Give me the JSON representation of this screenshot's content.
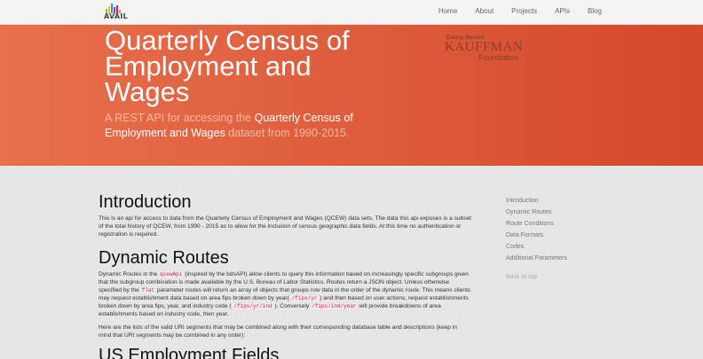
{
  "navbar": {
    "logo_text": "AVAIL",
    "logo_colors": [
      "#8bc34a",
      "#ffc107",
      "#03a9f4",
      "#e91e63",
      "#9c27b0",
      "#ff9800"
    ],
    "links": [
      "Home",
      "About",
      "Projects",
      "APIs",
      "Blog"
    ]
  },
  "hero": {
    "title": "Quarterly Census of Employment and Wages",
    "subtitle_pre": "A REST API for accessing the ",
    "subtitle_highlight": "Quarterly Census of Employment and Wages",
    "subtitle_post": " dataset from 1990-2015.",
    "sponsor": {
      "top": "Ewing Marion",
      "main": "KAUFFMAN",
      "bottom": "Foundation"
    },
    "colors": {
      "start": "#e8704c",
      "end": "#d4492b"
    }
  },
  "intro": {
    "heading": "Introduction",
    "text": "This is an api for access to data from the Quarterly Census of Employment and Wages (QCEW) data sets. The data this api exposes is a subset of the total history of QCEW, from 1990 - 2015 as to allow for the inclusion of census geographic data fields. At this time no authentication or registration is required."
  },
  "dynamic": {
    "heading": "Dynamic Routes",
    "p1_a": "Dynamic Routes in the ",
    "p1_code1": "qcewApi",
    "p1_b": " (inspired by the bdsAPI) allow clients to query this information based on increasingly specific subgroups given that the subgroup combination is made available by the U.S. Bureau of Labor Statistics. Routes return a JSON object. Unless otherwise specified by the ",
    "p1_code2": "flat",
    "p1_c": " parameter routes will return an array of objects that groups row data in the order of the dynamic route. This means clients may request establishment data based on area fips broken down by year( ",
    "p1_code3": "/fips/yr",
    "p1_d": " ) and then based on user actions, request establishments broken down by area fips, year, and industry code ( ",
    "p1_code4": "/fips/yr/ind",
    "p1_e": " ). Conversely ",
    "p1_code5": "/fips/ind/year",
    "p1_f": " will provide breakdowns of area establishments based on industry code, then year.",
    "p2": "Here are the lists of the valid URI segments that may be combined along with their corresponding database table and descriptions (keep in mind that URI segments may be combined in any order):"
  },
  "us_fields": {
    "heading": "US Employment Fields"
  },
  "sidebar": {
    "items": [
      "Introduction",
      "Dynamic Routes",
      "Route Conditions",
      "Data Formats",
      "Codes",
      "Additional Parameters"
    ],
    "back_to_top": "Back to top"
  }
}
